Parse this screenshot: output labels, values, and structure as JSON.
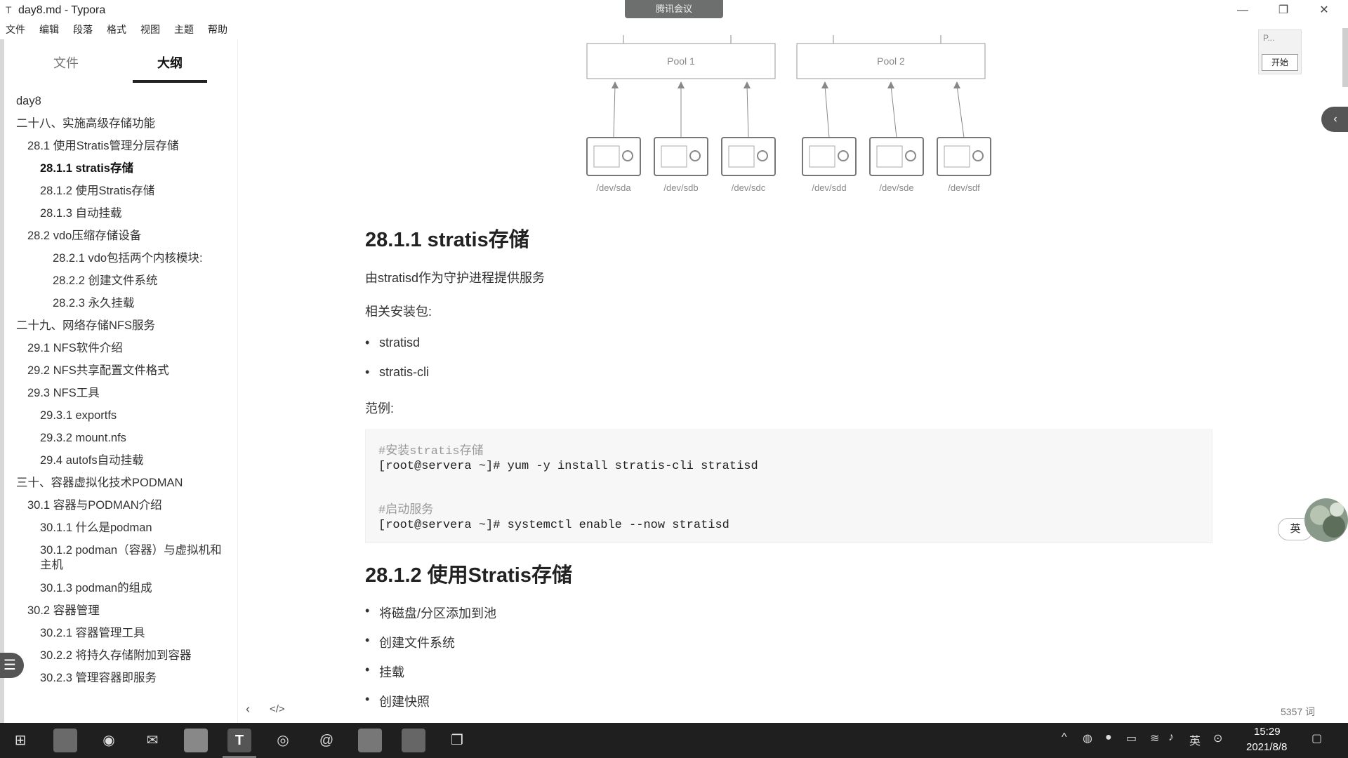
{
  "window": {
    "app_icon": "T",
    "title": "day8.md - Typora",
    "meeting_label": "腾讯会议",
    "min": "—",
    "restore": "❐",
    "close": "✕"
  },
  "menu": [
    "文件",
    "编辑",
    "段落",
    "格式",
    "视图",
    "主题",
    "帮助"
  ],
  "sidebar": {
    "tab_files": "文件",
    "tab_outline": "大纲",
    "outline": [
      {
        "label": "day8",
        "level": 0
      },
      {
        "label": "二十八、实施高级存储功能",
        "level": 0
      },
      {
        "label": "28.1 使用Stratis管理分层存储",
        "level": 1
      },
      {
        "label": "28.1.1 stratis存储",
        "level": 2,
        "active": true
      },
      {
        "label": "28.1.2 使用Stratis存储",
        "level": 2
      },
      {
        "label": "28.1.3 自动挂载",
        "level": 2
      },
      {
        "label": "28.2 vdo压缩存储设备",
        "level": 1
      },
      {
        "label": "28.2.1 vdo包括两个内核模块:",
        "level": 3
      },
      {
        "label": "28.2.2 创建文件系统",
        "level": 3
      },
      {
        "label": "28.2.3 永久挂载",
        "level": 3
      },
      {
        "label": "二十九、网络存储NFS服务",
        "level": 0
      },
      {
        "label": "29.1 NFS软件介绍",
        "level": 1
      },
      {
        "label": "29.2 NFS共享配置文件格式",
        "level": 1
      },
      {
        "label": "29.3 NFS工具",
        "level": 1
      },
      {
        "label": "29.3.1 exportfs",
        "level": 2
      },
      {
        "label": "29.3.2 mount.nfs",
        "level": 2
      },
      {
        "label": "29.4 autofs自动挂载",
        "level": 2
      },
      {
        "label": "三十、容器虚拟化技术PODMAN",
        "level": 0
      },
      {
        "label": "30.1 容器与PODMAN介绍",
        "level": 1
      },
      {
        "label": "30.1.1 什么是podman",
        "level": 2
      },
      {
        "label": "30.1.2 podman（容器）与虚拟机和主机",
        "level": 2,
        "wrap": true
      },
      {
        "label": "30.1.3 podman的组成",
        "level": 2
      },
      {
        "label": "30.2 容器管理",
        "level": 1
      },
      {
        "label": "30.2.1 容器管理工具",
        "level": 2
      },
      {
        "label": "30.2.2 将持久存储附加到容器",
        "level": 2
      },
      {
        "label": "30.2.3 管理容器即服务",
        "level": 2
      }
    ],
    "toggle_icon": "☰"
  },
  "diagram": {
    "pools": [
      "Pool 1",
      "Pool 2"
    ],
    "disks": [
      "/dev/sda",
      "/dev/sdb",
      "/dev/sdc",
      "/dev/sdd",
      "/dev/sde",
      "/dev/sdf"
    ]
  },
  "doc": {
    "h_2811": "28.1.1 stratis存储",
    "p_daemon": "由stratisd作为守护进程提供服务",
    "p_packages": "相关安装包:",
    "b_stratisd": "stratisd",
    "b_stratiscli": "stratis-cli",
    "p_example": "范例:",
    "code": {
      "c1": "#安装stratis存储",
      "l1": "[root@servera ~]# yum -y install stratis-cli stratisd",
      "c2": "#启动服务",
      "l2": "[root@servera ~]# systemctl enable --now stratisd"
    },
    "h_2812": "28.1.2 使用Stratis存储",
    "steps": [
      "将磁盘/分区添加到池",
      "创建文件系统",
      "挂载",
      "创建快照"
    ]
  },
  "bottom": {
    "prev": "‹",
    "source": "</>",
    "word_count": "5357 词"
  },
  "right": {
    "p_label": "P...",
    "start_button": "开始",
    "handle": "‹",
    "ime": "英"
  },
  "taskbar": {
    "time": "15:29",
    "date": "2021/8/8",
    "tray_ime": "英"
  }
}
